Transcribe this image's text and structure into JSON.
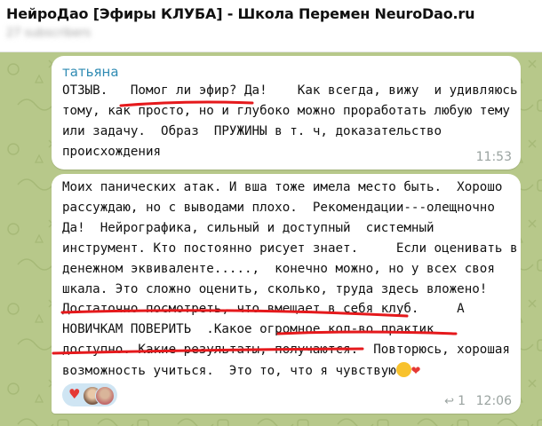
{
  "header": {
    "title": "НейроДао [Эфиры КЛУБА] - Школа Перемен NeuroDao.ru",
    "subtitle": "27 subscribers"
  },
  "messages": [
    {
      "author": "татьяна",
      "text": "ОТЗЫВ.   Помог ли эфир? Да!    Как всегда, вижу  и удивляюсь\nтому, как просто, но и глубоко можно проработать любую тему\nили задачу.  Образ  ПРУЖИНЫ в т. ч, доказательство\nпроисхождения",
      "time": "11:53"
    },
    {
      "text_main": "Моих панических атак. И вша тоже имела место быть.  Хорошо\nрассуждаю, но с выводами плохо.  Рекомендации---олещночно\nДа!  Нейрографика, сильный и доступный  системный\nинструмент. Кто постоянно рисует знает.     Если оценивать в\nденежном эквиваленте.....,  конечно можно, но у всех своя\nшкала. Это сложно оценить, сколько, труда здесь вложено!\nДостаточно посмотреть, что вмещает в себя клуб.     А\nНОВИЧКАМ ПОВЕРИТЬ  .Какое огромное кол-во практик\nдоступно. Какие результаты, получаются.  Повторюсь, хорошая\nвозможность учиться.  Это то, что я чувствую",
      "time": "12:06",
      "replies": "1"
    }
  ],
  "reactions": {
    "icon": "heart"
  },
  "colors": {
    "background": "#b7c88a",
    "author": "#2f8bb3",
    "underline": "#e5191c",
    "reaction_pill": "#cfe5f3"
  }
}
